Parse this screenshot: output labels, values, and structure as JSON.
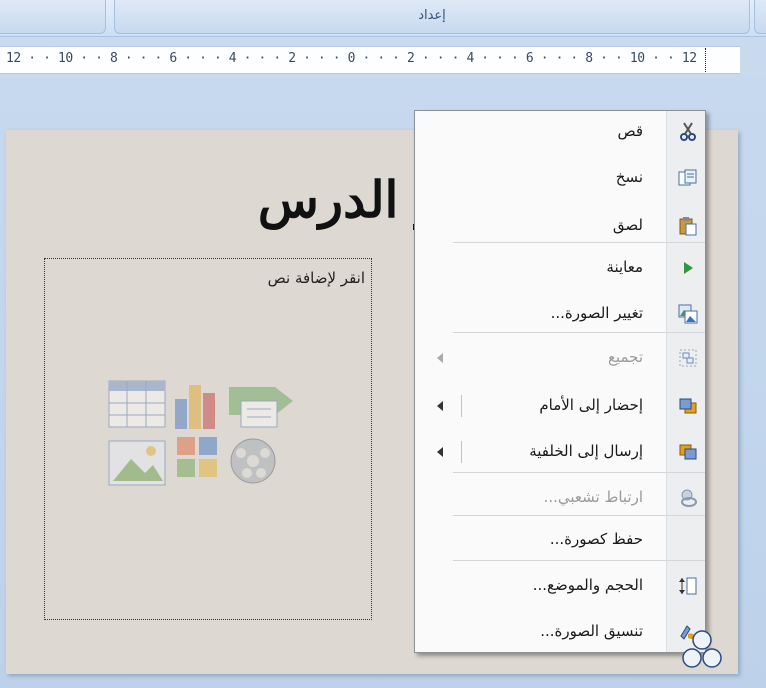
{
  "ribbon": {
    "group_label": "إعداد"
  },
  "ruler": {
    "text": "12 · · 10 · · 8 · · · 6 · · · 4 · · · 2 · · · 0 · · · 2 · · · 4 · · · 6 · · · 8 · · 10 · · 12"
  },
  "slide": {
    "title": "ر الدرس",
    "placeholder_text": "انقر لإضافة نص"
  },
  "context_menu": {
    "items": [
      {
        "label": "قص",
        "icon": "scissors-icon",
        "enabled": true
      },
      {
        "label": "نسخ",
        "icon": "copy-icon",
        "enabled": true
      },
      {
        "label": "لصق",
        "icon": "paste-icon",
        "enabled": true
      },
      {
        "label": "معاينة",
        "icon": "play-icon",
        "enabled": true
      },
      {
        "label": "تغيير الصورة...",
        "icon": "change-picture-icon",
        "enabled": true
      },
      {
        "label": "تجميع",
        "icon": "group-icon",
        "enabled": false,
        "submenu": true
      },
      {
        "label": "إحضار إلى الأمام",
        "icon": "bring-forward-icon",
        "enabled": true,
        "submenu": true
      },
      {
        "label": "إرسال إلى الخلفية",
        "icon": "send-backward-icon",
        "enabled": true,
        "submenu": true
      },
      {
        "label": "ارتباط تشعبي...",
        "icon": "hyperlink-icon",
        "enabled": false
      },
      {
        "label": "حفظ كصورة...",
        "icon": "save-as-picture-icon",
        "enabled": true
      },
      {
        "label": "الحجم والموضع...",
        "icon": "size-position-icon",
        "enabled": true
      },
      {
        "label": "تنسيق الصورة...",
        "icon": "format-picture-icon",
        "enabled": true
      }
    ]
  },
  "colors": {
    "ribbon_bg": "#cddff4",
    "slide_bg": "#ded8d2",
    "menu_bg": "#fafafa",
    "disabled_text": "#9a9a9a"
  }
}
